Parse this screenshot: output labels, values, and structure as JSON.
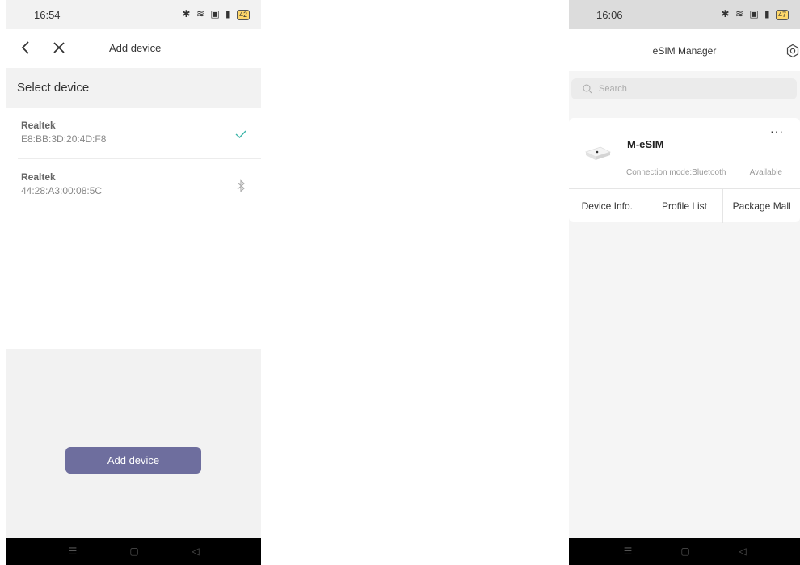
{
  "left": {
    "status": {
      "time": "16:54",
      "battery": "42"
    },
    "header": {
      "title": "Add device"
    },
    "section_title": "Select device",
    "devices": [
      {
        "name": "Realtek",
        "mac": "E8:BB:3D:20:4D:F8",
        "status_icon": "check-icon"
      },
      {
        "name": "Realtek",
        "mac": "44:28:A3:00:08:5C",
        "status_icon": "bluetooth-icon"
      }
    ],
    "add_button": "Add device"
  },
  "right": {
    "status": {
      "time": "16:06",
      "battery": "47"
    },
    "header": {
      "title": "eSIM Manager"
    },
    "search": {
      "placeholder": "Search"
    },
    "card": {
      "name": "M-eSIM",
      "more": "···",
      "connection_mode": "Connection mode:Bluetooth",
      "availability": "Available",
      "tabs": [
        "Device Info.",
        "Profile List",
        "Package Mall"
      ]
    }
  },
  "colors": {
    "accent_button": "#6e6e9e",
    "check": "#3cb4a8"
  }
}
